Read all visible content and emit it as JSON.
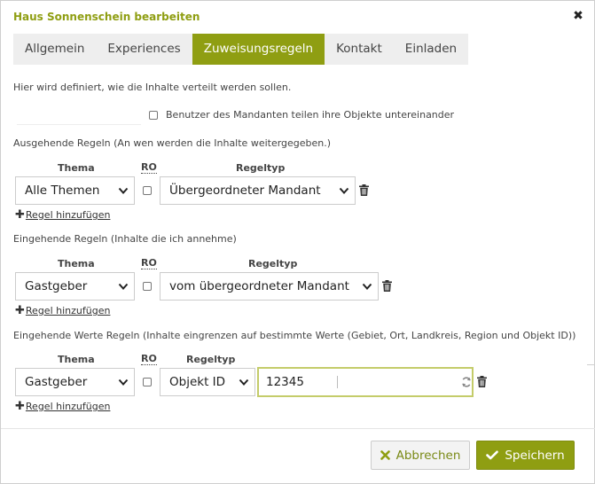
{
  "dialog": {
    "title": "Haus Sonnenschein bearbeiten"
  },
  "tabs": [
    {
      "label": "Allgemein",
      "active": false
    },
    {
      "label": "Experiences",
      "active": false
    },
    {
      "label": "Zuweisungsregeln",
      "active": true
    },
    {
      "label": "Kontakt",
      "active": false
    },
    {
      "label": "Einladen",
      "active": false
    }
  ],
  "intro_text": "Hier wird definiert, wie die Inhalte verteilt werden sollen.",
  "share_option": {
    "label": "Benutzer des Mandanten teilen ihre Objekte untereinander",
    "checked": false
  },
  "columns": {
    "thema": "Thema",
    "ro": "RO",
    "regeltyp": "Regeltyp"
  },
  "add_rule_label": "Regel hinzufügen",
  "sections": {
    "outgoing": {
      "label": "Ausgehende Regeln (An wen werden die Inhalte weitergegeben.)",
      "rule": {
        "thema": "Alle Themen",
        "ro_checked": false,
        "regeltyp": "Übergeordneter Mandant"
      }
    },
    "incoming": {
      "label": "Eingehende Regeln (Inhalte die ich annehme)",
      "rule": {
        "thema": "Gastgeber",
        "ro_checked": false,
        "regeltyp": "vom übergeordneter Mandant"
      }
    },
    "incoming_values": {
      "label": "Eingehende Werte Regeln (Inhalte eingrenzen auf bestimmte Werte (Gebiet, Ort, Landkreis, Region und Objekt ID))",
      "rule": {
        "thema": "Gastgeber",
        "ro_checked": false,
        "regeltyp": "Objekt ID",
        "value": "12345"
      }
    }
  },
  "buttons": {
    "cancel": "Abbrechen",
    "save": "Speichern"
  },
  "colors": {
    "accent": "#8f9e12",
    "input_focus": "#c4cc6a"
  },
  "icons": {
    "close": "close-icon",
    "chevron": "chevron-down-icon",
    "trash": "trash-icon",
    "plus": "plus-icon",
    "refresh": "refresh-icon",
    "cancel": "x-icon",
    "save": "check-icon"
  }
}
